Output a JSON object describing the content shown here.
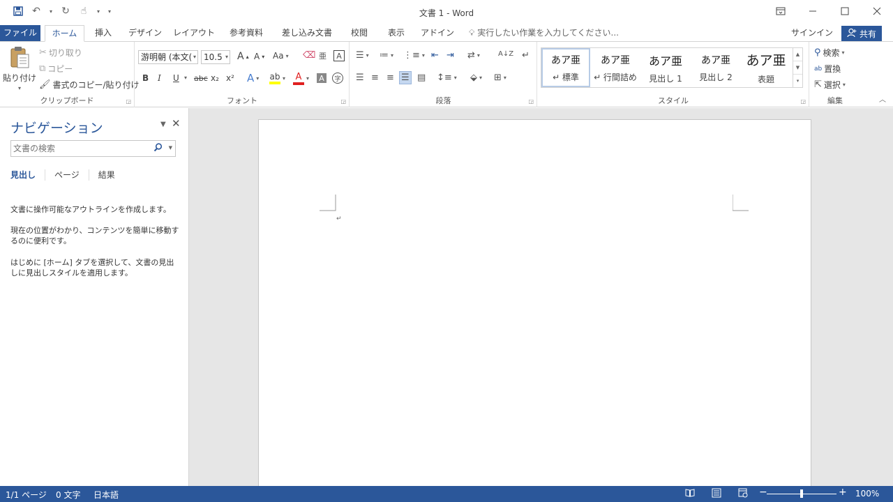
{
  "window": {
    "title": "文書 1 - Word",
    "controls": [
      "ribbon-display-icon",
      "minimize-icon",
      "maximize-icon",
      "close-icon"
    ]
  },
  "qat": {
    "icons": [
      "save-icon",
      "undo-icon",
      "redo-icon",
      "touch-mode-icon",
      "customize-qat-icon"
    ]
  },
  "tabs": [
    {
      "label": "ファイル"
    },
    {
      "label": "ホーム"
    },
    {
      "label": "挿入"
    },
    {
      "label": "デザイン"
    },
    {
      "label": "レイアウト"
    },
    {
      "label": "参考資料"
    },
    {
      "label": "差し込み文書"
    },
    {
      "label": "校閲"
    },
    {
      "label": "表示"
    },
    {
      "label": "アドイン"
    }
  ],
  "tell_me": {
    "text": "実行したい作業を入力してください..."
  },
  "account": {
    "signin": "サインイン",
    "share": "共有"
  },
  "ribbon": {
    "clipboard": {
      "label": "クリップボード",
      "paste": "貼り付け",
      "cut": "切り取り",
      "copy": "コピー",
      "format_painter": "書式のコピー/貼り付け"
    },
    "font": {
      "label": "フォント",
      "font_name": "游明朝 (本文(",
      "font_size": "10.5",
      "change_case": "Aa",
      "bold": "B",
      "italic": "I",
      "underline": "U",
      "strike": "abc",
      "subscript": "x₂",
      "superscript": "x²",
      "grow": "A",
      "shrink": "A",
      "font_color": "A",
      "highlight_color": "#ffff00",
      "font_color_value": "#e02020"
    },
    "paragraph": {
      "label": "段落"
    },
    "styles": {
      "label": "スタイル",
      "items": [
        {
          "sample": "あア亜",
          "name": "↵ 標準"
        },
        {
          "sample": "あア亜",
          "name": "↵ 行間詰め"
        },
        {
          "sample": "あア亜",
          "name": "見出し 1"
        },
        {
          "sample": "あア亜",
          "name": "見出し 2"
        },
        {
          "sample": "あア亜",
          "name": "表題"
        }
      ]
    },
    "editing": {
      "label": "編集",
      "find": "検索",
      "replace": "置換",
      "select": "選択"
    }
  },
  "nav_pane": {
    "title": "ナビゲーション",
    "search_placeholder": "文書の検索",
    "tabs": [
      "見出し",
      "ページ",
      "結果"
    ],
    "p1": "文書に操作可能なアウトラインを作成します。",
    "p2": "現在の位置がわかり、コンテンツを簡単に移動するのに便利です。",
    "p3": "はじめに [ホーム] タブを選択して、文書の見出しに見出しスタイルを適用します。"
  },
  "document": {
    "paragraph_mark": "↵"
  },
  "status": {
    "page": "1/1 ページ",
    "words": "0 文字",
    "language": "日本語",
    "zoom_minus": "−",
    "zoom_plus": "+",
    "zoom": "100%",
    "zoom_value_pct": 100
  },
  "colors": {
    "accent": "#2b579a"
  }
}
